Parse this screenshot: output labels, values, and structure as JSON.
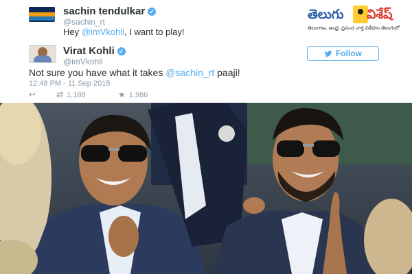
{
  "reply_tweet": {
    "display_name": "sachin tendulkar",
    "handle": "@sachin_rt",
    "text_before": "Hey ",
    "mention": "@imVkohli",
    "text_after": ", I want to play!"
  },
  "main_tweet": {
    "display_name": "Virat Kohli",
    "handle": "@imVkohli",
    "follow_label": "Follow",
    "text_before": "Not sure you have what it takes ",
    "mention": "@sachin_rt",
    "text_after": " paaji!",
    "timestamp": "12:48 PM - 11 Sep 2015",
    "retweet_count": "1,188",
    "favorite_count": "1,986"
  },
  "logo": {
    "left_word": "తెలుగు",
    "right_word": "విశేష్",
    "tagline": "తెలంగాణ, ఆంధ్ర, ప్రపంచ వార్త విశేషాల తెలుగులో"
  },
  "icons": {
    "reply": "reply-icon",
    "retweet": "retweet-icon",
    "favorite": "star-icon",
    "verified": "verified-badge-icon",
    "follow": "twitter-bird-icon"
  },
  "colors": {
    "twitter_blue": "#55acee",
    "text": "#292f33",
    "muted": "#8899a6",
    "logo_blue": "#2b5fa8",
    "logo_red": "#e03a2c"
  }
}
